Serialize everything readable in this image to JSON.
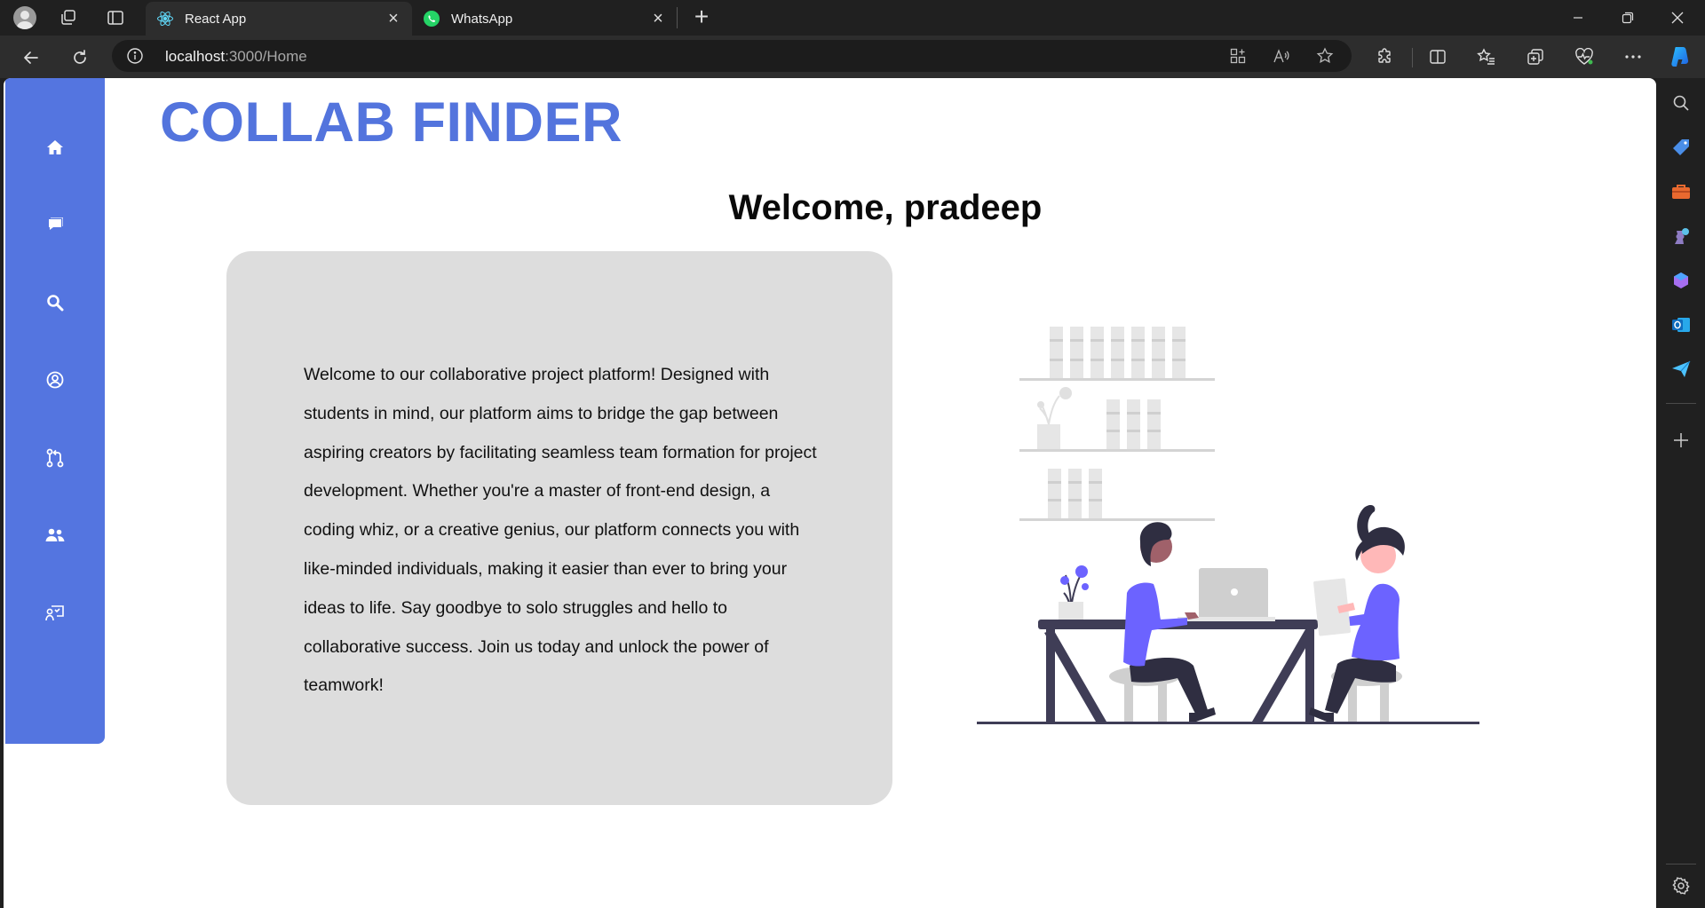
{
  "browser": {
    "tabs": [
      {
        "title": "React App",
        "active": true,
        "favicon": "react-icon"
      },
      {
        "title": "WhatsApp",
        "active": false,
        "favicon": "whatsapp-icon"
      }
    ],
    "url": {
      "host": "localhost",
      "path": ":3000/Home"
    }
  },
  "app": {
    "brand": "COLLAB FINDER",
    "welcome": "Welcome, pradeep",
    "about": "Welcome to our collaborative project platform! Designed with students in mind, our platform aims to bridge the gap between aspiring creators by facilitating seamless team formation for project development. Whether you're a master of front-end design, a coding whiz, or a creative genius, our platform connects you with like-minded individuals, making it easier than ever to bring your ideas to life. Say goodbye to solo struggles and hello to collaborative success. Join us today and unlock the power of teamwork!",
    "nav": [
      {
        "icon": "home-icon"
      },
      {
        "icon": "chat-icon"
      },
      {
        "icon": "search-icon"
      },
      {
        "icon": "user-circle-icon"
      },
      {
        "icon": "pull-request-icon"
      },
      {
        "icon": "users-icon"
      },
      {
        "icon": "presentation-icon"
      }
    ]
  },
  "colors": {
    "brand": "#5374dd",
    "nav_bg": "#5475e0",
    "card_bg": "#dddddd",
    "accent_purple": "#6c63ff"
  }
}
